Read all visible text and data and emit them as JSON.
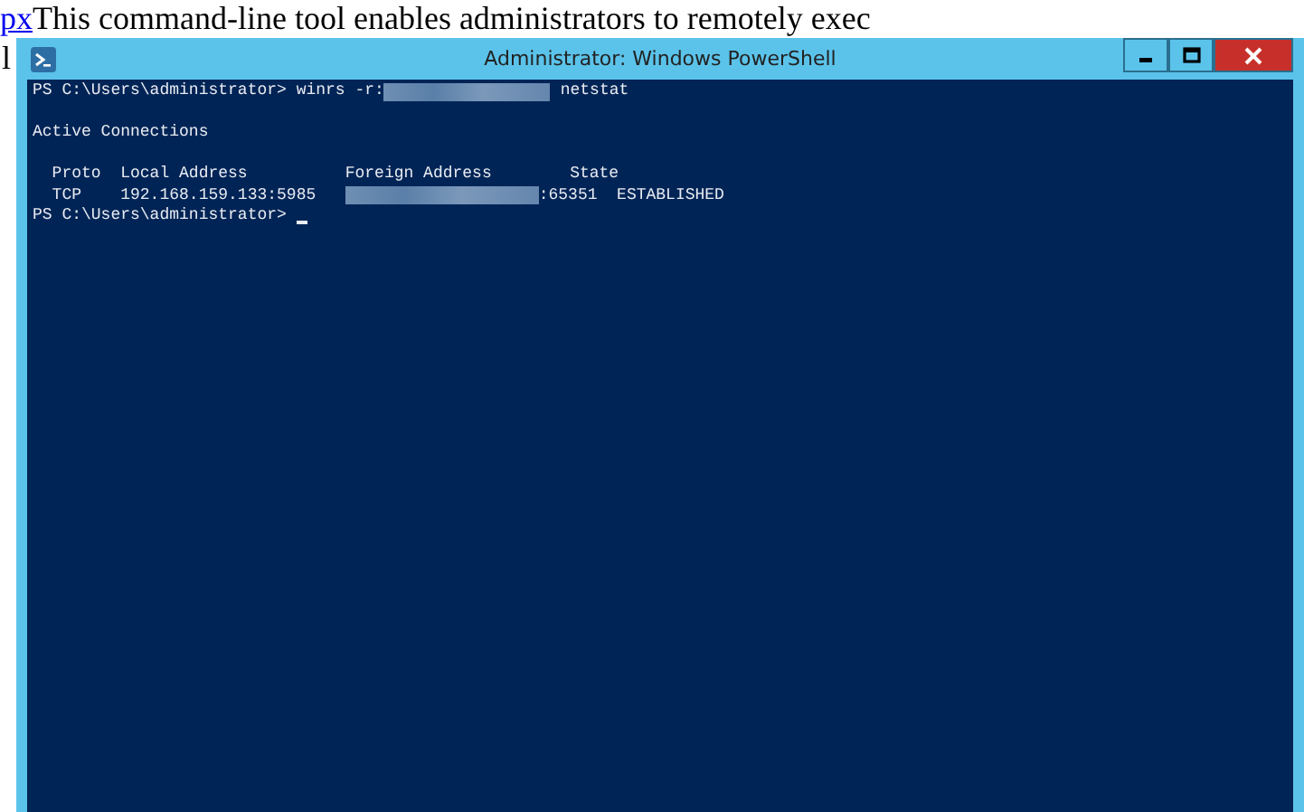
{
  "page_text": {
    "link": "px",
    "text": "This command-line tool enables administrators to remotely exec",
    "second_line": "l"
  },
  "window": {
    "title": "Administrator: Windows PowerShell"
  },
  "console": {
    "lines": [
      {
        "kind": "command",
        "prompt": "PS C:\\Users\\administrator> ",
        "before": "winrs -r:",
        "after": " netstat"
      },
      {
        "kind": "blank"
      },
      {
        "kind": "text",
        "text": "Active Connections"
      },
      {
        "kind": "blank"
      },
      {
        "kind": "columns",
        "cells": [
          "  Proto  ",
          "Local Address          ",
          "Foreign Address        ",
          "State"
        ]
      },
      {
        "kind": "row",
        "cells": [
          "  TCP    ",
          "192.168.159.133:5985   "
        ],
        "after": ":65351",
        "state": "  ESTABLISHED"
      },
      {
        "kind": "prompt",
        "prompt": "PS C:\\Users\\administrator> ",
        "cursor": true
      }
    ]
  }
}
